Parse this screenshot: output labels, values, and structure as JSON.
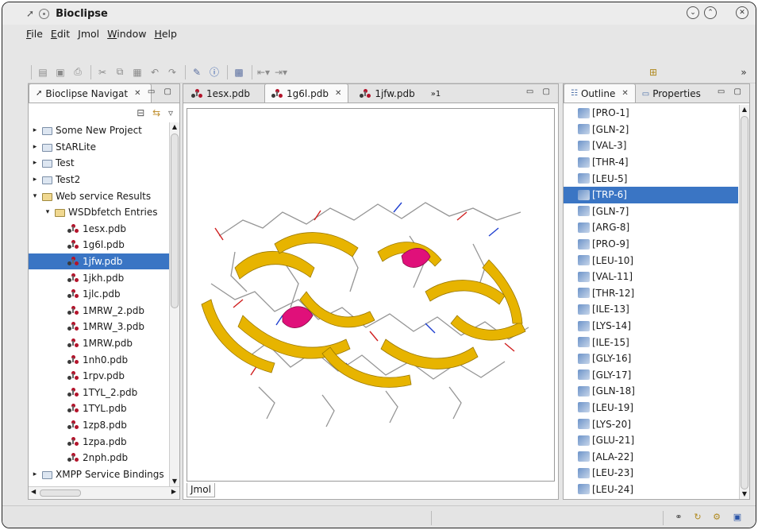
{
  "window": {
    "title": "Bioclipse"
  },
  "menu": [
    "File",
    "Edit",
    "Jmol",
    "Window",
    "Help"
  ],
  "navigator": {
    "tab_label": "Bioclipse Navigat",
    "items": [
      {
        "label": "Some New Project",
        "level": 0,
        "twisty": "▸",
        "open": false
      },
      {
        "label": "StARLite",
        "level": 0,
        "twisty": "▸",
        "open": false
      },
      {
        "label": "Test",
        "level": 0,
        "twisty": "▸",
        "open": false
      },
      {
        "label": "Test2",
        "level": 0,
        "twisty": "▸",
        "open": false
      },
      {
        "label": "Web service Results",
        "level": 0,
        "twisty": "▾",
        "open": true
      },
      {
        "label": "WSDbfetch Entries",
        "level": 1,
        "twisty": "▾",
        "open": true
      },
      {
        "label": "1esx.pdb",
        "level": 2
      },
      {
        "label": "1g6l.pdb",
        "level": 2
      },
      {
        "label": "1jfw.pdb",
        "level": 2,
        "selected": true
      },
      {
        "label": "1jkh.pdb",
        "level": 2
      },
      {
        "label": "1jlc.pdb",
        "level": 2
      },
      {
        "label": "1MRW_2.pdb",
        "level": 2
      },
      {
        "label": "1MRW_3.pdb",
        "level": 2
      },
      {
        "label": "1MRW.pdb",
        "level": 2
      },
      {
        "label": "1nh0.pdb",
        "level": 2
      },
      {
        "label": "1rpv.pdb",
        "level": 2
      },
      {
        "label": "1TYL_2.pdb",
        "level": 2
      },
      {
        "label": "1TYL.pdb",
        "level": 2
      },
      {
        "label": "1zp8.pdb",
        "level": 2
      },
      {
        "label": "1zpa.pdb",
        "level": 2
      },
      {
        "label": "2nph.pdb",
        "level": 2
      },
      {
        "label": "XMPP Service Bindings",
        "level": 0,
        "twisty": "▸",
        "open": false
      }
    ]
  },
  "editor": {
    "tabs": [
      {
        "label": "1esx.pdb",
        "active": false
      },
      {
        "label": "1g6l.pdb",
        "active": true
      },
      {
        "label": "1jfw.pdb",
        "active": false
      }
    ],
    "overflow": "»1",
    "bottom_tab": "Jmol"
  },
  "outline": {
    "tab_label": "Outline",
    "properties_label": "Properties",
    "items": [
      "[PRO-1]",
      "[GLN-2]",
      "[VAL-3]",
      "[THR-4]",
      "[LEU-5]",
      "[TRP-6]",
      "[GLN-7]",
      "[ARG-8]",
      "[PRO-9]",
      "[LEU-10]",
      "[VAL-11]",
      "[THR-12]",
      "[ILE-13]",
      "[LYS-14]",
      "[ILE-15]",
      "[GLY-16]",
      "[GLY-17]",
      "[GLN-18]",
      "[LEU-19]",
      "[LYS-20]",
      "[GLU-21]",
      "[ALA-22]",
      "[LEU-23]",
      "[LEU-24]"
    ],
    "selected": "[TRP-6]"
  },
  "colors": {
    "selection": "#3a75c4",
    "ribbon": "#e7b400",
    "helix": "#e0107a"
  }
}
